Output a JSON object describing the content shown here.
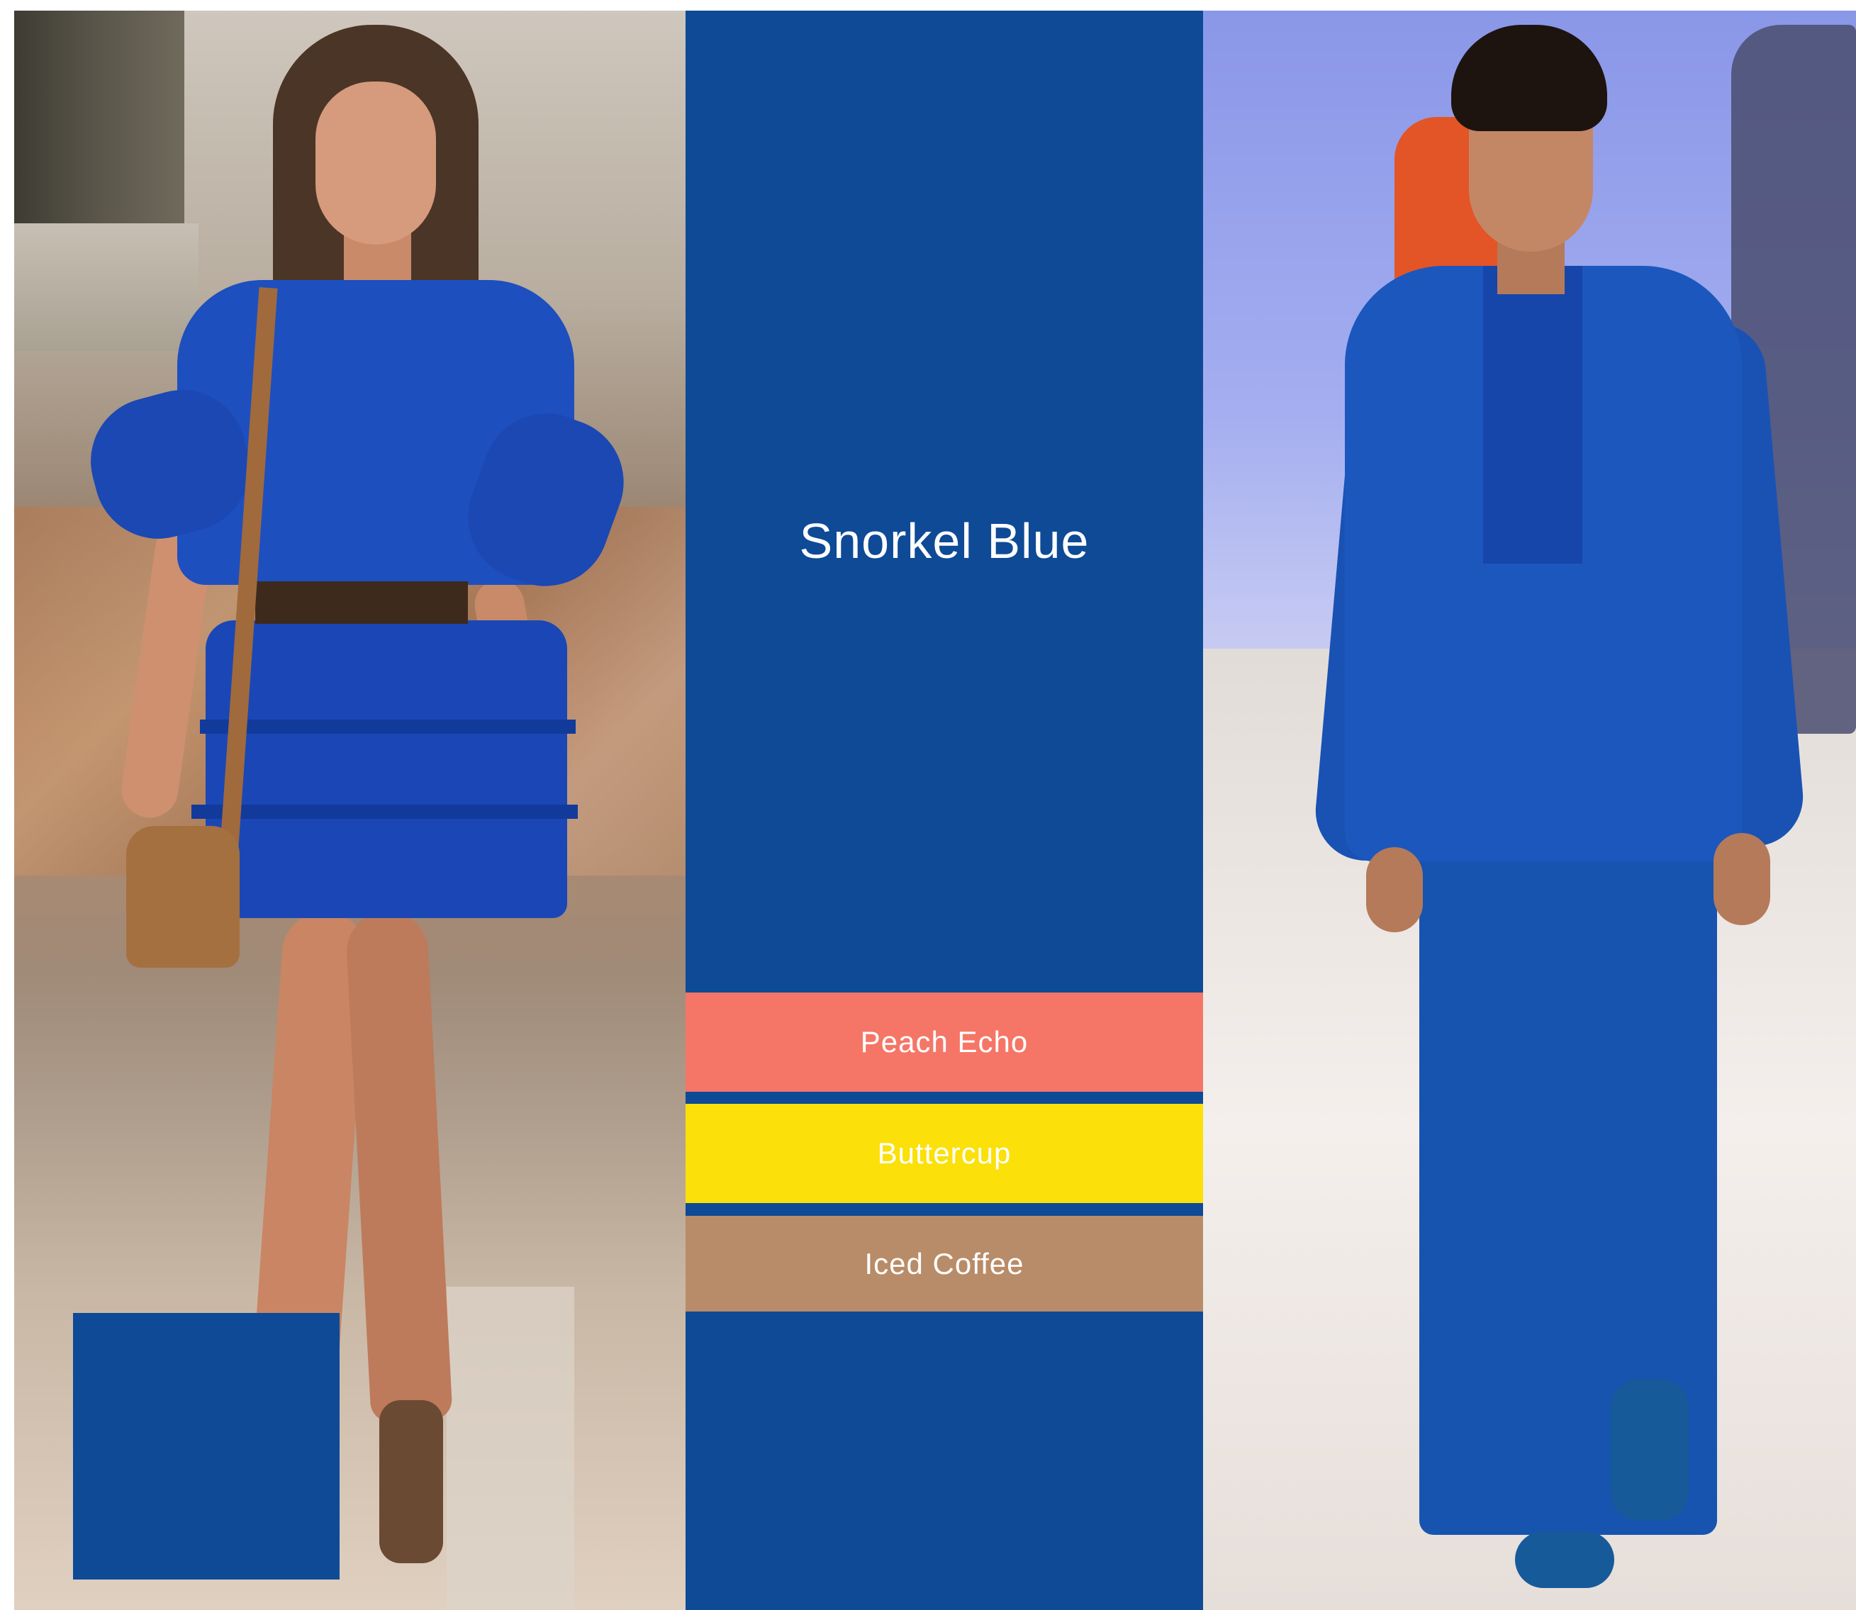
{
  "palette": {
    "main_color_name": "Snorkel Blue",
    "accents": [
      {
        "label": "Peach Echo",
        "color": "#f57667"
      },
      {
        "label": "Buttercup",
        "color": "#fbe009"
      },
      {
        "label": "Iced Coffee",
        "color": "#b88c68"
      }
    ],
    "main_color": "#0e4a96"
  },
  "images": {
    "left": "photo-runway-woman-blue-ruffle-dress",
    "right": "photo-runway-man-blue-suit"
  }
}
